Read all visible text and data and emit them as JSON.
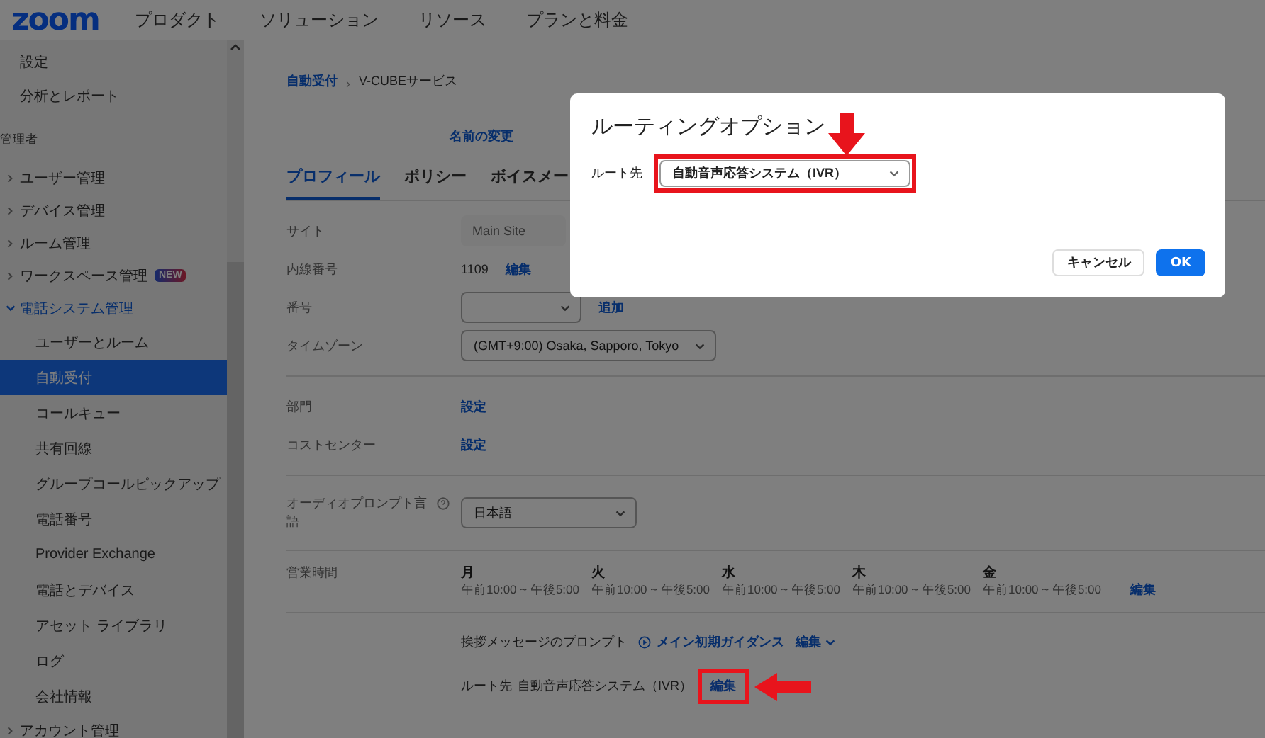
{
  "header": {
    "logo": "zoom",
    "nav": [
      "プロダクト",
      "ソリューション",
      "リソース",
      "プランと料金"
    ]
  },
  "sidebar": {
    "items": [
      {
        "kind": "link",
        "label": "設定"
      },
      {
        "kind": "link",
        "label": "分析とレポート"
      },
      {
        "kind": "header",
        "label": "管理者"
      },
      {
        "kind": "group",
        "label": "ユーザー管理",
        "expanded": false
      },
      {
        "kind": "group",
        "label": "デバイス管理",
        "expanded": false
      },
      {
        "kind": "group",
        "label": "ルーム管理",
        "expanded": false
      },
      {
        "kind": "group",
        "label": "ワークスペース管理",
        "expanded": false,
        "badge": "NEW"
      },
      {
        "kind": "group",
        "label": "電話システム管理",
        "expanded": true,
        "children": [
          {
            "label": "ユーザーとルーム",
            "selected": false
          },
          {
            "label": "自動受付",
            "selected": true
          },
          {
            "label": "コールキュー",
            "selected": false
          },
          {
            "label": "共有回線",
            "selected": false
          },
          {
            "label": "グループコールピックアップ",
            "selected": false
          },
          {
            "label": "電話番号",
            "selected": false
          },
          {
            "label": "Provider Exchange",
            "selected": false
          },
          {
            "label": "電話とデバイス",
            "selected": false
          },
          {
            "label": "アセット ライブラリ",
            "selected": false
          },
          {
            "label": "ログ",
            "selected": false
          },
          {
            "label": "会社情報",
            "selected": false
          }
        ]
      },
      {
        "kind": "group",
        "label": "アカウント管理",
        "expanded": false
      }
    ]
  },
  "breadcrumb": {
    "parent": "自動受付",
    "separator": "›",
    "current": "V-CUBEサービス"
  },
  "rename_link": "名前の変更",
  "tabs": [
    {
      "label": "プロフィール",
      "selected": true
    },
    {
      "label": "ポリシー",
      "selected": false
    },
    {
      "label": "ボイスメー",
      "selected": false
    }
  ],
  "sections": [
    [
      {
        "label": "サイト",
        "kind": "readonly",
        "value": "Main Site"
      },
      {
        "label": "内線番号",
        "kind": "text",
        "value": "1109",
        "link": "編集"
      },
      {
        "label": "番号",
        "kind": "select",
        "link": "追加"
      },
      {
        "label": "タイムゾーン",
        "kind": "select",
        "value": "(GMT+9:00) Osaka, Sapporo, Tokyo"
      }
    ],
    [
      {
        "label": "部門",
        "kind": "link",
        "link": "設定"
      },
      {
        "label": "コストセンター",
        "kind": "link",
        "link": "設定"
      }
    ],
    [
      {
        "label": "オーディオプロンプト言語",
        "kind": "select",
        "value": "日本語",
        "help": true
      }
    ],
    [
      {
        "label": "営業時間",
        "kind": "hours",
        "link": "編集",
        "days": [
          {
            "day": "月",
            "hours": "午前10:00 ~ 午後5:00"
          },
          {
            "day": "火",
            "hours": "午前10:00 ~ 午後5:00"
          },
          {
            "day": "水",
            "hours": "午前10:00 ~ 午後5:00"
          },
          {
            "day": "木",
            "hours": "午前10:00 ~ 午後5:00"
          },
          {
            "day": "金",
            "hours": "午前10:00 ~ 午後5:00"
          }
        ]
      }
    ]
  ],
  "greeting": {
    "label": "挨拶メッセージのプロンプト",
    "prompt": "メイン初期ガイダンス",
    "edit": "編集"
  },
  "route": {
    "label": "ルート先",
    "value": "自動音声応答システム（IVR）",
    "edit": "編集",
    "highlighted": true
  },
  "dialog": {
    "title": "ルーティングオプション",
    "route_label": "ルート先",
    "route_value": "自動音声応答システム（IVR）",
    "highlighted": true,
    "buttons": [
      {
        "label": "キャンセル",
        "kind": "secondary"
      },
      {
        "label": "OK",
        "kind": "primary"
      }
    ]
  }
}
